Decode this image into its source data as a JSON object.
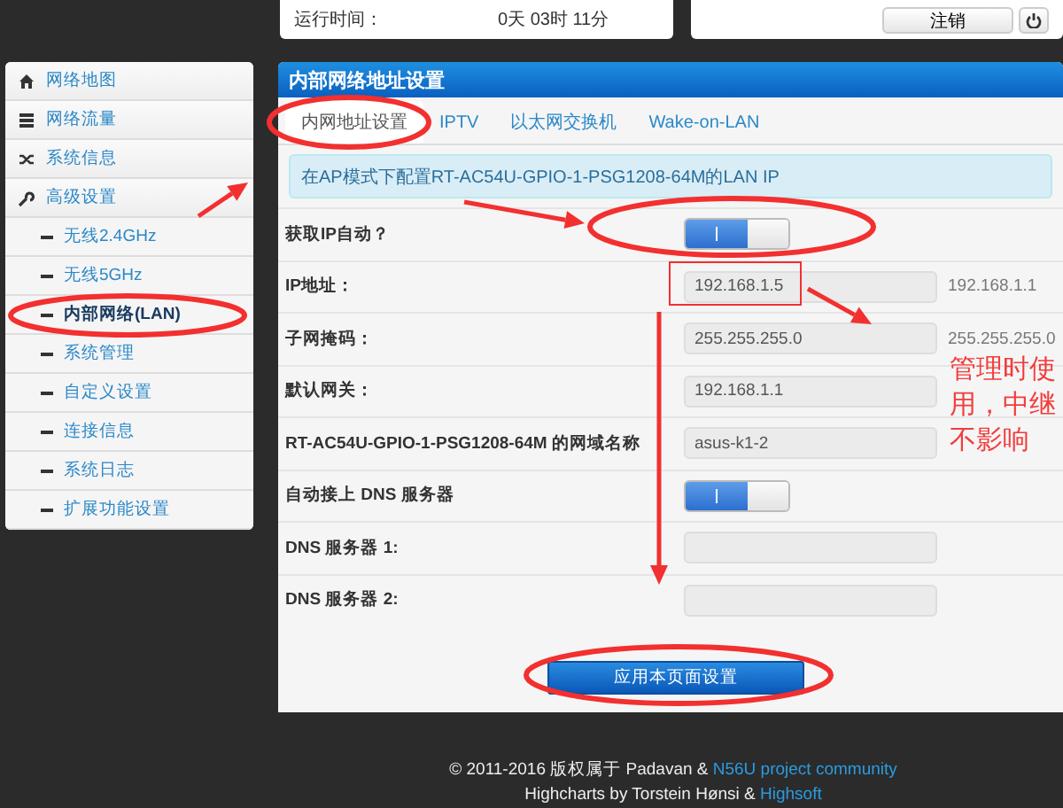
{
  "top_status": {
    "label": "运行时间：",
    "value": "0天 03时 11分"
  },
  "top_actions": {
    "logout_button": "注销"
  },
  "sidebar": {
    "items": [
      {
        "label": "网络地图",
        "selected": false
      },
      {
        "label": "网络流量",
        "selected": false
      },
      {
        "label": "系统信息",
        "selected": false
      },
      {
        "label": "高级设置",
        "selected": false,
        "children": [
          {
            "label": "无线2.4GHz",
            "selected": false
          },
          {
            "label": "无线5GHz",
            "selected": false
          },
          {
            "label": "内部网络(LAN)",
            "selected": true
          },
          {
            "label": "系统管理",
            "selected": false
          },
          {
            "label": "自定义设置",
            "selected": false
          },
          {
            "label": "连接信息",
            "selected": false
          },
          {
            "label": "系统日志",
            "selected": false
          },
          {
            "label": "扩展功能设置",
            "selected": false
          }
        ]
      }
    ]
  },
  "panel": {
    "title": "内部网络地址设置",
    "tabs": [
      {
        "label": "内网地址设置",
        "selected": true
      },
      {
        "label": "IPTV",
        "selected": false
      },
      {
        "label": "以太网交换机",
        "selected": false
      },
      {
        "label": "Wake-on-LAN",
        "selected": false
      }
    ],
    "info": "在AP模式下配置RT-AC54U-GPIO-1-PSG1208-64M的LAN IP",
    "rows": [
      {
        "kind": "toggle",
        "label": "获取IP自动？",
        "on": true
      },
      {
        "kind": "field",
        "label": "IP地址：",
        "value": "192.168.1.5",
        "hint": "192.168.1.1"
      },
      {
        "kind": "field",
        "label": "子网掩码：",
        "value": "255.255.255.0",
        "hint": "255.255.255.0"
      },
      {
        "kind": "field",
        "label": "默认网关：",
        "value": "192.168.1.1"
      },
      {
        "kind": "field",
        "label": "RT-AC54U-GPIO-1-PSG1208-64M 的网域名称",
        "value": "asus-k1-2"
      },
      {
        "kind": "toggle",
        "label": "自动接上 DNS 服务器",
        "on": true
      },
      {
        "kind": "field",
        "label": "DNS 服务器 1:"
      },
      {
        "kind": "field",
        "label": "DNS 服务器 2:"
      }
    ],
    "apply_button": "应用本页面设置"
  },
  "annotation": {
    "text": "管理时使用，中继不影响"
  },
  "footer": {
    "lines": [
      [
        {
          "text": "© 2011-2016 版权属于 Padavan & ",
          "link": false
        },
        {
          "text": "N56U project community",
          "link": true
        }
      ],
      [
        {
          "text": "Highcharts by Torstein Hønsi & ",
          "link": false
        },
        {
          "text": "Highsoft",
          "link": true
        }
      ]
    ]
  }
}
